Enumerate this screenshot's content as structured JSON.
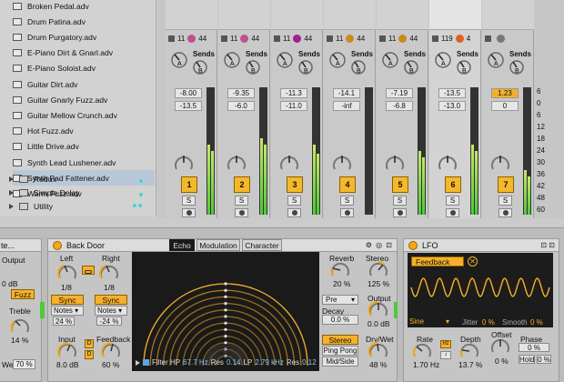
{
  "browser": {
    "files": [
      "Broken Pedal.adv",
      "Drum Patina.adv",
      "Drum Purgatory.adv",
      "E-Piano Dirt & Gnarl.adv",
      "E-Piano Soloist.adv",
      "Guitar Dirt.adv",
      "Guitar Gnarly Fuzz.adv",
      "Guitar Mellow Crunch.adv",
      "Hot Fuzz.adv",
      "Little Drive.adv",
      "Synth Lead Lushener.adv",
      "Synth Pad Fattener.adv",
      "Warm Fuzz.adv"
    ],
    "selected_index": 11,
    "folders": [
      "Redux",
      "Simple Delay",
      "Utility"
    ]
  },
  "mixer": {
    "sends_label": "Sends",
    "knob_a": "A",
    "knob_b": "B",
    "tracks": [
      {
        "num": "1",
        "in": "11",
        "out": "44",
        "ball": "#c05090",
        "vol": "-8.00",
        "peak": "-13.5",
        "meter_l": 0.55,
        "meter_r": 0.5
      },
      {
        "num": "2",
        "in": "11",
        "out": "44",
        "ball": "#c05090",
        "vol": "-9.35",
        "peak": "-6.0",
        "meter_l": 0.6,
        "meter_r": 0.55
      },
      {
        "num": "3",
        "in": "11",
        "out": "44",
        "ball": "#a0208f",
        "vol": "-11.3",
        "peak": "-11.0",
        "meter_l": 0.55,
        "meter_r": 0.48
      },
      {
        "num": "4",
        "in": "11",
        "out": "44",
        "ball": "#c98a20",
        "vol": "-14.1",
        "peak": "-inf",
        "meter_l": 0,
        "meter_r": 0
      },
      {
        "num": "5",
        "in": "11",
        "out": "44",
        "ball": "#c98a20",
        "vol": "-7.19",
        "peak": "-6.8",
        "meter_l": 0.5,
        "meter_r": 0.45
      },
      {
        "num": "6",
        "in": "119",
        "out": "4",
        "ball": "#e06020",
        "vol": "-13.5",
        "peak": "-13.0",
        "meter_l": 0.55,
        "meter_r": 0.5
      },
      {
        "num": "7",
        "in": "",
        "out": "",
        "ball": "#777777",
        "vol": "1.23",
        "peak": "0",
        "meter_l": 0.35,
        "meter_r": 0.3
      }
    ],
    "ticks": [
      "6",
      "0",
      "6",
      "12",
      "18",
      "24",
      "30",
      "36",
      "42",
      "48",
      "60"
    ]
  },
  "echo_left": {
    "output_label": "Output",
    "output_val": "0 dB",
    "fuzz": "Fuzz",
    "treble_label": "Treble",
    "treble_val": "14 %",
    "wet_label": "Wet",
    "wet_val": "70 %",
    "title_partial": "te..."
  },
  "echo": {
    "title": "Back Door",
    "tabs": [
      "Echo",
      "Modulation",
      "Character"
    ],
    "left_label": "Left",
    "left_val": "1/8",
    "right_label": "Right",
    "right_val": "1/8",
    "sync": "Sync",
    "notes": "Notes",
    "left_pct": "24 %",
    "right_pct": "-24 %",
    "input_label": "Input",
    "input_val": "8.0 dB",
    "d": "D",
    "feedback_label": "Feedback",
    "feedback_val": "60 %",
    "filter_hp_label": "Filter HP",
    "filter_hp": "67.7 Hz",
    "res_label": "Res",
    "res1": "0.14",
    "lp_label": "LP",
    "lp": "2.79 kHz",
    "res2": "0.12",
    "reverb_label": "Reverb",
    "reverb_val": "20 %",
    "stereo_label": "Stereo",
    "stereo_val": "125 %",
    "pre": "Pre",
    "decay_label": "Decay",
    "decay_val": "0.0 %",
    "output_label": "Output",
    "output_val": "0.0 dB",
    "mode_stereo": "Stereo",
    "mode_pingpong": "Ping Pong",
    "mode_midside": "Mid/Side",
    "drywet_label": "Dry/Wet",
    "drywet_val": "48 %"
  },
  "lfo": {
    "title": "LFO",
    "target": "Feedback",
    "shape": "Sine",
    "jitter_label": "Jitter",
    "jitter_val": "0 %",
    "smooth_label": "Smooth",
    "smooth_val": "0 %",
    "rate_label": "Rate",
    "rate_val": "1.70 Hz",
    "hz": "Hz",
    "depth_label": "Depth",
    "depth_val": "13.7 %",
    "offset_label": "Offset",
    "offset_val": "0 %",
    "phase_label": "Phase",
    "phase_val": "0 %",
    "hold": "Hold",
    "hold_val": "0 %"
  },
  "colors": {
    "accent": "#f6b12a",
    "meter": "#4fc83a",
    "teal": "#49d3c8"
  }
}
